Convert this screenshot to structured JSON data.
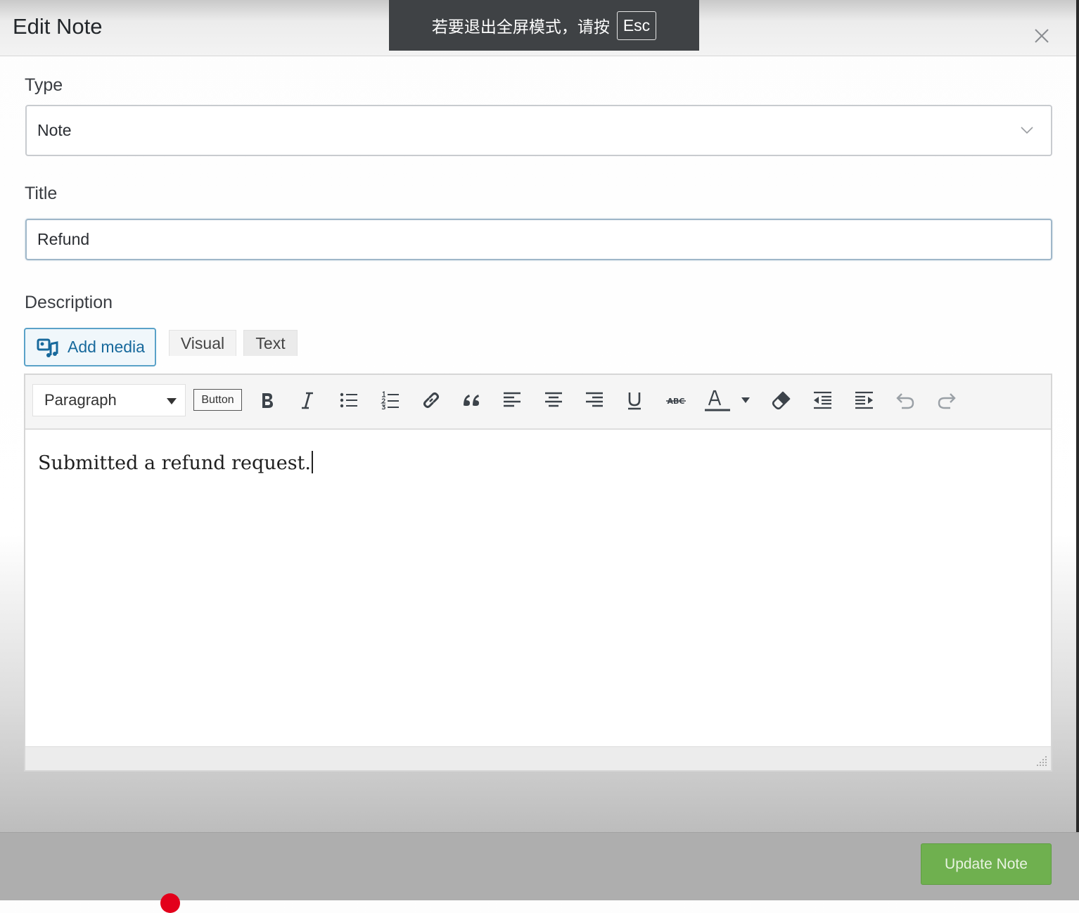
{
  "modal": {
    "title": "Edit Note"
  },
  "fullscreen_toast": {
    "message": "若要退出全屏模式，请按",
    "key": "Esc"
  },
  "type_field": {
    "label": "Type",
    "value": "Note"
  },
  "title_field": {
    "label": "Title",
    "value": "Refund"
  },
  "description": {
    "label": "Description",
    "add_media_label": "Add media",
    "tabs": [
      {
        "label": "Visual",
        "active": true
      },
      {
        "label": "Text",
        "active": false
      }
    ],
    "toolbar": {
      "format_value": "Paragraph",
      "button_label": "Button",
      "icons": [
        "bold-icon",
        "italic-icon",
        "bulleted-list-icon",
        "numbered-list-icon",
        "link-icon",
        "blockquote-icon",
        "align-left-icon",
        "align-center-icon",
        "align-right-icon",
        "underline-icon",
        "strikethrough-icon",
        "text-color-icon",
        "clear-formatting-icon",
        "outdent-icon",
        "indent-icon",
        "undo-icon",
        "redo-icon"
      ]
    },
    "content": "Submitted a refund request."
  },
  "footer": {
    "update_label": "Update Note"
  },
  "colors": {
    "primary_green": "#6fb04f",
    "link_blue": "#17699c"
  }
}
